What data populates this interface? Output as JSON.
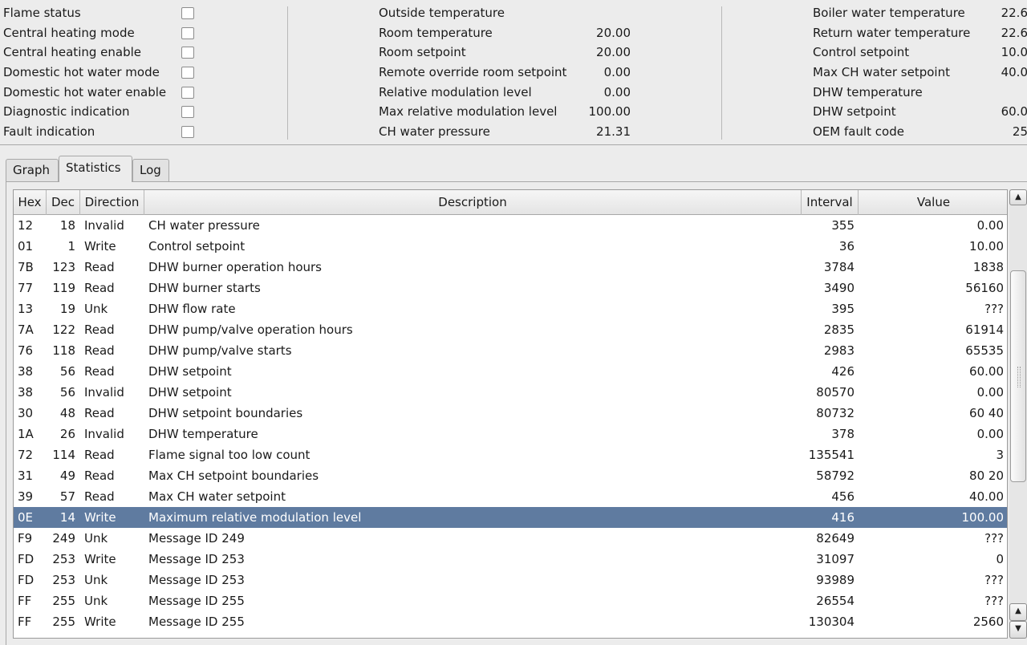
{
  "flags": [
    {
      "label": "Flame status",
      "checked": false
    },
    {
      "label": "Central heating mode",
      "checked": false
    },
    {
      "label": "Central heating enable",
      "checked": false
    },
    {
      "label": "Domestic hot water mode",
      "checked": false
    },
    {
      "label": "Domestic hot water enable",
      "checked": false
    },
    {
      "label": "Diagnostic indication",
      "checked": false
    },
    {
      "label": "Fault indication",
      "checked": false
    }
  ],
  "readings_mid": [
    {
      "label": "Outside temperature",
      "value": ""
    },
    {
      "label": "Room temperature",
      "value": "20.00"
    },
    {
      "label": "Room setpoint",
      "value": "20.00"
    },
    {
      "label": "Remote override room setpoint",
      "value": "0.00"
    },
    {
      "label": "Relative modulation level",
      "value": "0.00"
    },
    {
      "label": "Max relative modulation level",
      "value": "100.00"
    },
    {
      "label": "CH water pressure",
      "value": "21.31"
    }
  ],
  "readings_right": [
    {
      "label": "Boiler water temperature",
      "value": "22.6"
    },
    {
      "label": "Return water temperature",
      "value": "22.6"
    },
    {
      "label": "Control setpoint",
      "value": "10.0"
    },
    {
      "label": "Max CH water setpoint",
      "value": "40.0"
    },
    {
      "label": "DHW temperature",
      "value": ""
    },
    {
      "label": "DHW setpoint",
      "value": "60.0"
    },
    {
      "label": "OEM fault code",
      "value": "25"
    }
  ],
  "tabs": [
    {
      "label": "Graph",
      "active": false
    },
    {
      "label": "Statistics",
      "active": true
    },
    {
      "label": "Log",
      "active": false
    }
  ],
  "table": {
    "columns": {
      "hex": "Hex",
      "dec": "Dec",
      "direction": "Direction",
      "description": "Description",
      "interval": "Interval",
      "value": "Value"
    },
    "rows": [
      {
        "hex": "12",
        "dec": "18",
        "direction": "Invalid",
        "description": "CH water pressure",
        "interval": "355",
        "value": "0.00",
        "selected": false
      },
      {
        "hex": "01",
        "dec": "1",
        "direction": "Write",
        "description": "Control setpoint",
        "interval": "36",
        "value": "10.00",
        "selected": false
      },
      {
        "hex": "7B",
        "dec": "123",
        "direction": "Read",
        "description": "DHW burner operation hours",
        "interval": "3784",
        "value": "1838",
        "selected": false
      },
      {
        "hex": "77",
        "dec": "119",
        "direction": "Read",
        "description": "DHW burner starts",
        "interval": "3490",
        "value": "56160",
        "selected": false
      },
      {
        "hex": "13",
        "dec": "19",
        "direction": "Unk",
        "description": "DHW flow rate",
        "interval": "395",
        "value": "???",
        "selected": false
      },
      {
        "hex": "7A",
        "dec": "122",
        "direction": "Read",
        "description": "DHW pump/valve operation hours",
        "interval": "2835",
        "value": "61914",
        "selected": false
      },
      {
        "hex": "76",
        "dec": "118",
        "direction": "Read",
        "description": "DHW pump/valve starts",
        "interval": "2983",
        "value": "65535",
        "selected": false
      },
      {
        "hex": "38",
        "dec": "56",
        "direction": "Read",
        "description": "DHW setpoint",
        "interval": "426",
        "value": "60.00",
        "selected": false
      },
      {
        "hex": "38",
        "dec": "56",
        "direction": "Invalid",
        "description": "DHW setpoint",
        "interval": "80570",
        "value": "0.00",
        "selected": false
      },
      {
        "hex": "30",
        "dec": "48",
        "direction": "Read",
        "description": "DHW setpoint boundaries",
        "interval": "80732",
        "value": "60 40",
        "selected": false
      },
      {
        "hex": "1A",
        "dec": "26",
        "direction": "Invalid",
        "description": "DHW temperature",
        "interval": "378",
        "value": "0.00",
        "selected": false
      },
      {
        "hex": "72",
        "dec": "114",
        "direction": "Read",
        "description": "Flame signal too low count",
        "interval": "135541",
        "value": "3",
        "selected": false
      },
      {
        "hex": "31",
        "dec": "49",
        "direction": "Read",
        "description": "Max CH setpoint boundaries",
        "interval": "58792",
        "value": "80 20",
        "selected": false
      },
      {
        "hex": "39",
        "dec": "57",
        "direction": "Read",
        "description": "Max CH water setpoint",
        "interval": "456",
        "value": "40.00",
        "selected": false
      },
      {
        "hex": "0E",
        "dec": "14",
        "direction": "Write",
        "description": "Maximum relative modulation level",
        "interval": "416",
        "value": "100.00",
        "selected": true
      },
      {
        "hex": "F9",
        "dec": "249",
        "direction": "Unk",
        "description": "Message ID 249",
        "interval": "82649",
        "value": "???",
        "selected": false
      },
      {
        "hex": "FD",
        "dec": "253",
        "direction": "Write",
        "description": "Message ID 253",
        "interval": "31097",
        "value": "0",
        "selected": false
      },
      {
        "hex": "FD",
        "dec": "253",
        "direction": "Unk",
        "description": "Message ID 253",
        "interval": "93989",
        "value": "???",
        "selected": false
      },
      {
        "hex": "FF",
        "dec": "255",
        "direction": "Unk",
        "description": "Message ID 255",
        "interval": "26554",
        "value": "???",
        "selected": false
      },
      {
        "hex": "FF",
        "dec": "255",
        "direction": "Write",
        "description": "Message ID 255",
        "interval": "130304",
        "value": "2560",
        "selected": false
      }
    ]
  },
  "scrollbar": {
    "up_icon": "arrow-up",
    "down_icon": "arrow-down"
  },
  "colors": {
    "selection": "#5f7ba0",
    "window_bg": "#ececec"
  }
}
